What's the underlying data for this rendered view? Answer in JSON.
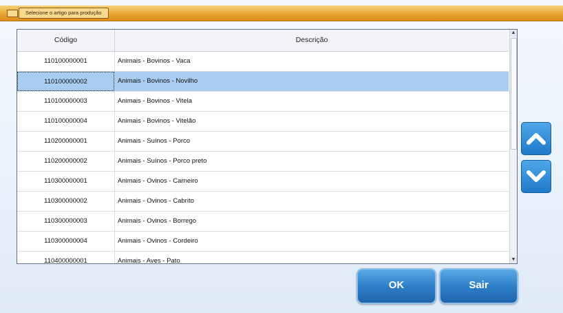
{
  "dialog": {
    "title": "Selecione o artigo para produção"
  },
  "colors": {
    "title_bar": "#e8a534",
    "selected_row": "#a9cdf1",
    "button_blue": "#2c7cc6"
  },
  "grid": {
    "headers": {
      "code": "Código",
      "description": "Descrição"
    },
    "selected_index": 1,
    "rows": [
      {
        "code": "110100000001",
        "description": "Animais - Bovinos - Vaca"
      },
      {
        "code": "110100000002",
        "description": "Animais - Bovinos - Novilho"
      },
      {
        "code": "110100000003",
        "description": "Animais - Bovinos - Vitela"
      },
      {
        "code": "110100000004",
        "description": "Animais - Bovinos - Vitelão"
      },
      {
        "code": "110200000001",
        "description": "Animais - Suínos - Porco"
      },
      {
        "code": "110200000002",
        "description": "Animais - Suínos - Porco preto"
      },
      {
        "code": "110300000001",
        "description": "Animais - Ovinos - Carneiro"
      },
      {
        "code": "110300000002",
        "description": "Animais - Ovinos - Cabrito"
      },
      {
        "code": "110300000003",
        "description": "Animais - Ovinos - Borrego"
      },
      {
        "code": "110300000004",
        "description": "Animais - Ovinos - Cordeiro"
      },
      {
        "code": "110400000001",
        "description": "Animais - Aves - Pato"
      }
    ]
  },
  "navigation": {
    "up_icon": "chevron-up-icon",
    "down_icon": "chevron-down-icon"
  },
  "actions": {
    "ok_label": "OK",
    "exit_label": "Sair"
  }
}
